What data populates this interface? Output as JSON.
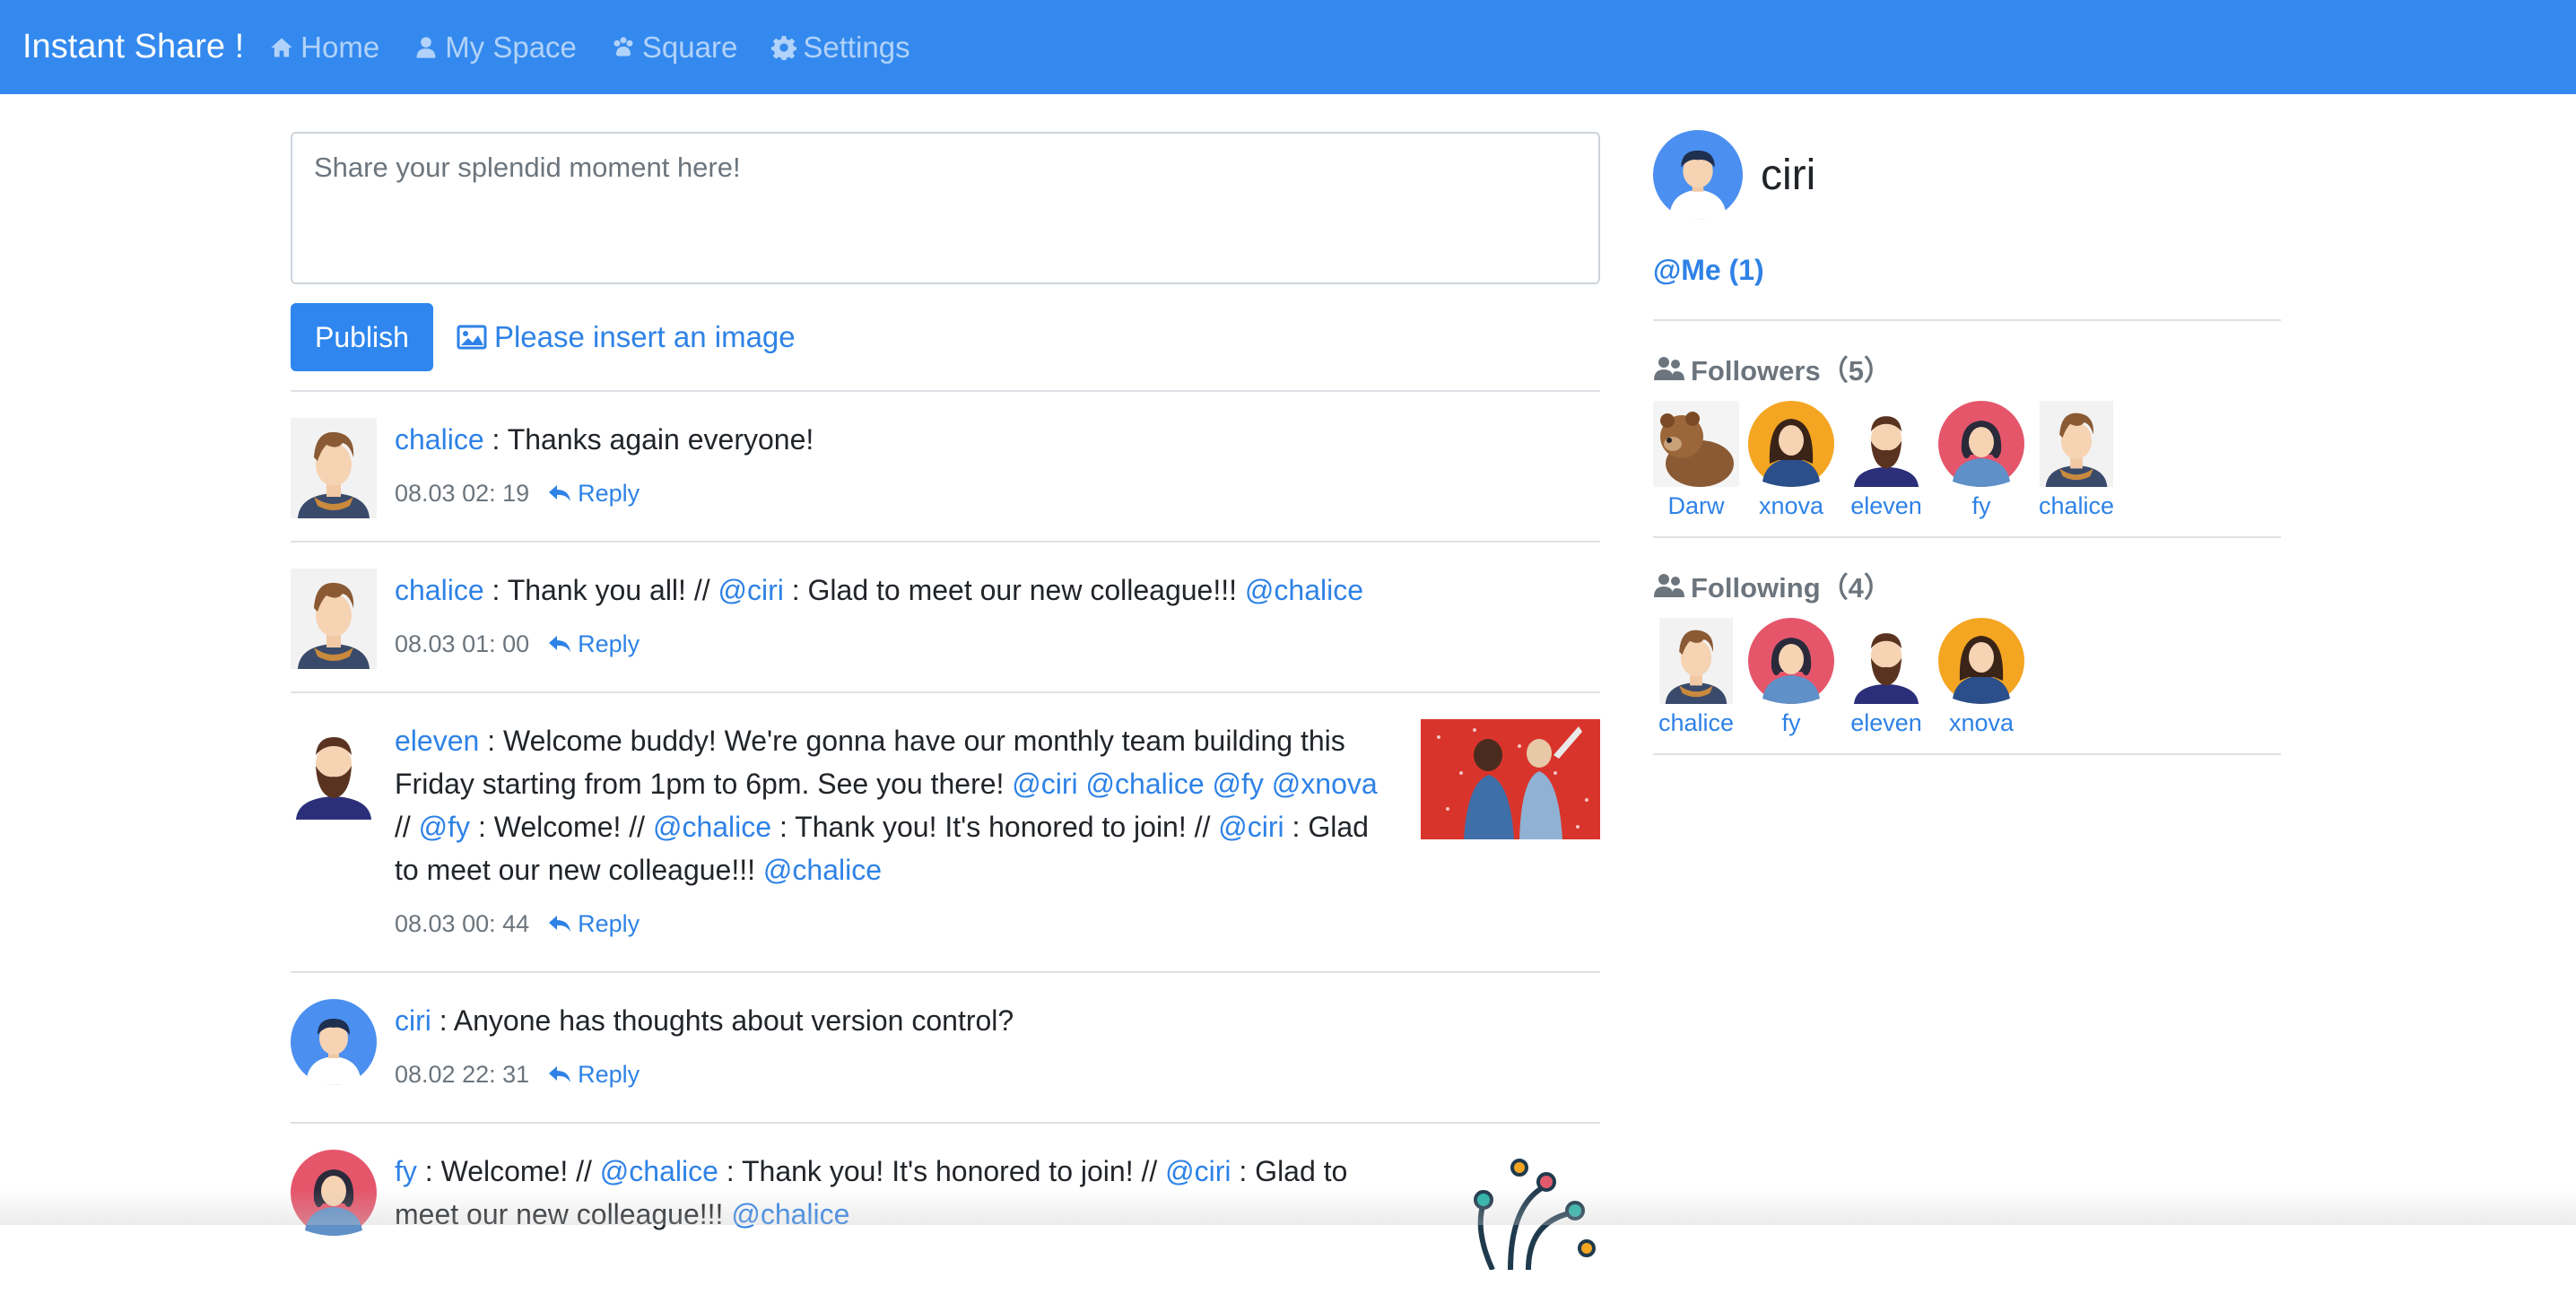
{
  "nav": {
    "brand": "Instant Share !",
    "items": [
      {
        "label": "Home",
        "icon": "home-icon"
      },
      {
        "label": "My Space",
        "icon": "user-icon"
      },
      {
        "label": "Square",
        "icon": "paw-icon"
      },
      {
        "label": "Settings",
        "icon": "gear-icon"
      }
    ]
  },
  "composer": {
    "placeholder": "Share your splendid moment here!",
    "publish_label": "Publish",
    "insert_image_label": "Please insert an image"
  },
  "posts": [
    {
      "author": "chalice",
      "segments": [
        {
          "t": " : Thanks again everyone!",
          "link": false
        }
      ],
      "time": "08.03 02: 19",
      "reply": "Reply"
    },
    {
      "author": "chalice",
      "segments": [
        {
          "t": " : Thank you all! // ",
          "link": false
        },
        {
          "t": "@ciri",
          "link": true
        },
        {
          "t": " : Glad to meet our new colleague!!! ",
          "link": false
        },
        {
          "t": "@chalice",
          "link": true
        }
      ],
      "time": "08.03 01: 00",
      "reply": "Reply"
    },
    {
      "author": "eleven",
      "segments": [
        {
          "t": " : Welcome buddy! We're gonna have our monthly team building this Friday starting from 1pm to 6pm. See you there! ",
          "link": false
        },
        {
          "t": "@ciri",
          "link": true
        },
        {
          "t": " ",
          "link": false
        },
        {
          "t": "@chalice",
          "link": true
        },
        {
          "t": " ",
          "link": false
        },
        {
          "t": "@fy",
          "link": true
        },
        {
          "t": " ",
          "link": false
        },
        {
          "t": "@xnova",
          "link": true
        },
        {
          "t": " // ",
          "link": false
        },
        {
          "t": "@fy",
          "link": true
        },
        {
          "t": " : Welcome! // ",
          "link": false
        },
        {
          "t": "@chalice",
          "link": true
        },
        {
          "t": " : Thank you! It's honored to join! // ",
          "link": false
        },
        {
          "t": "@ciri",
          "link": true
        },
        {
          "t": " : Glad to meet our new colleague!!! ",
          "link": false
        },
        {
          "t": "@chalice",
          "link": true
        }
      ],
      "time": "08.03 00: 44",
      "reply": "Reply"
    },
    {
      "author": "ciri",
      "segments": [
        {
          "t": " : Anyone has thoughts about version control?",
          "link": false
        }
      ],
      "time": "08.02 22: 31",
      "reply": "Reply"
    },
    {
      "author": "fy",
      "segments": [
        {
          "t": " : Welcome! // ",
          "link": false
        },
        {
          "t": "@chalice",
          "link": true
        },
        {
          "t": " : Thank you! It's honored to join! // ",
          "link": false
        },
        {
          "t": "@ciri",
          "link": true
        },
        {
          "t": " : Glad to meet our new colleague!!! ",
          "link": false
        },
        {
          "t": "@chalice",
          "link": true
        }
      ],
      "time": "",
      "reply": ""
    }
  ],
  "sidebar": {
    "username": "ciri",
    "me_link": "@Me (1)",
    "followers_title": "Followers（5）",
    "followers": [
      "Darw",
      "xnova",
      "eleven",
      "fy",
      "chalice"
    ],
    "following_title": "Following（4）",
    "following": [
      "chalice",
      "fy",
      "eleven",
      "xnova"
    ]
  },
  "colors": {
    "navbar": "#3389ee",
    "link": "#2e82e6",
    "button": "#2e86ee"
  }
}
